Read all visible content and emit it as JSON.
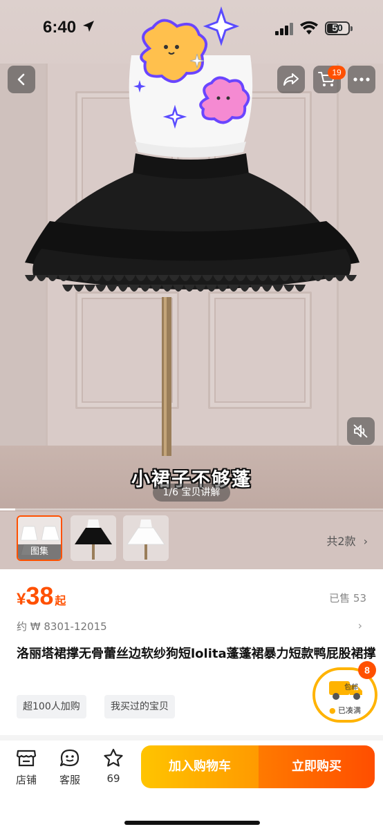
{
  "status_bar": {
    "time": "6:40",
    "battery": "50"
  },
  "nav": {
    "cart_badge": "19"
  },
  "media": {
    "caption": "小裙子不够蓬",
    "page_indicator": "1/6 宝贝讲解",
    "progress": 0.04
  },
  "thumbnails": {
    "items": [
      {
        "label": "图集",
        "active": true
      },
      {
        "label": "",
        "active": false
      },
      {
        "label": "",
        "active": false
      }
    ],
    "variant_count": "共2款"
  },
  "product": {
    "price_symbol": "¥",
    "price": "38",
    "price_suffix": "起",
    "sold": "已售 53",
    "approx_price": "约 ₩ 8301-12015",
    "title": "洛丽塔裙撑无骨蕾丝边软纱狗短lolita蓬蓬裙暴力短款鸭屁股裙撑",
    "tags": [
      "超100人加购",
      "我买过的宝贝"
    ]
  },
  "bundle": {
    "badge": "8",
    "truck_label": "包邮",
    "status": "已凑满"
  },
  "bottom_bar": {
    "shop_label": "店铺",
    "service_label": "客服",
    "favorite_count": "69",
    "add_to_cart": "加入购物车",
    "buy_now": "立即购买"
  },
  "colors": {
    "accent": "#ff5000",
    "cart_button": "#ffb000",
    "buy_button": "#ff5a00"
  }
}
